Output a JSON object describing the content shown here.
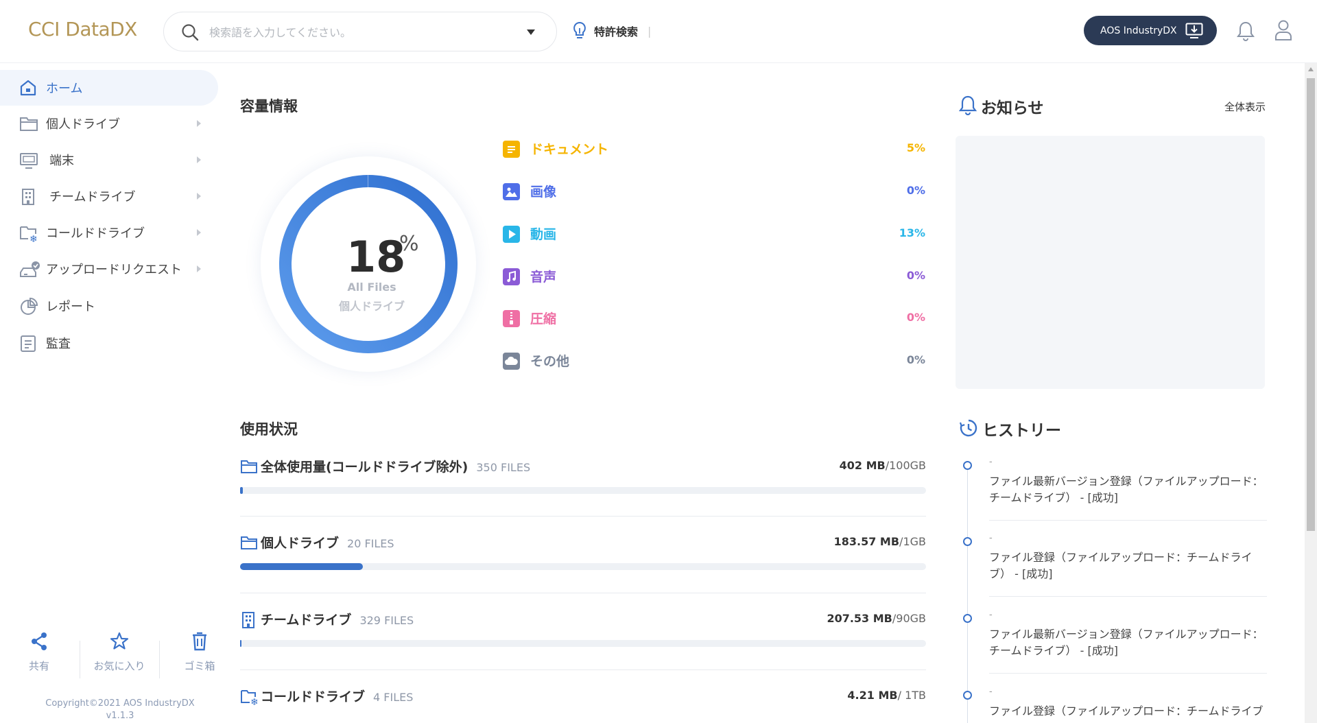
{
  "app": {
    "logo": "CCI DataDX"
  },
  "header": {
    "search_placeholder": "検索語を入力してください。",
    "patent_search": "特許検索",
    "separator": "|",
    "aos_button": "AOS IndustryDX"
  },
  "sidebar": {
    "items": [
      {
        "label": "ホーム",
        "icon": "home-icon",
        "active": true,
        "arrow": false
      },
      {
        "label": "個人ドライブ",
        "icon": "folder-icon",
        "arrow": true
      },
      {
        "label": "端末",
        "icon": "monitor-icon",
        "arrow": true
      },
      {
        "label": "チームドライブ",
        "icon": "building-icon",
        "arrow": true
      },
      {
        "label": "コールドドライブ",
        "icon": "cold-drive-icon",
        "arrow": true
      },
      {
        "label": "アップロードリクエスト",
        "icon": "upload-request-icon",
        "arrow": true
      },
      {
        "label": "レポート",
        "icon": "pie-chart-icon",
        "arrow": false
      },
      {
        "label": "監査",
        "icon": "audit-icon",
        "arrow": false
      }
    ],
    "bottom": {
      "share": "共有",
      "favorites": "お気に入り",
      "trash": "ゴミ箱"
    },
    "copyright": "Copyright©2021 AOS IndustryDX",
    "version": "v1.1.3"
  },
  "capacity": {
    "title": "容量情報",
    "percent": "18",
    "percent_sign": "%",
    "percent_value": 18,
    "all_files": "All Files",
    "drive_label": "個人ドライブ",
    "categories": [
      {
        "name": "ドキュメント",
        "value": "5%",
        "color": "#f5b400"
      },
      {
        "name": "画像",
        "value": "0%",
        "color": "#4f6ee8"
      },
      {
        "name": "動画",
        "value": "13%",
        "color": "#29b6e8"
      },
      {
        "name": "音声",
        "value": "0%",
        "color": "#8b5bd6"
      },
      {
        "name": "圧縮",
        "value": "0%",
        "color": "#ef6fa4"
      },
      {
        "name": "その他",
        "value": "0%",
        "color": "#7b8699"
      }
    ]
  },
  "usage": {
    "title": "使用状況",
    "rows": [
      {
        "name": "全体使用量(コールドドライブ除外)",
        "files": "350 FILES",
        "used": "402 MB",
        "total": "/100GB",
        "fill": 0.004
      },
      {
        "name": "個人ドライブ",
        "files": "20 FILES",
        "used": "183.57 MB",
        "total": "/1GB",
        "fill": 0.1793
      },
      {
        "name": "チームドライブ",
        "files": "329 FILES",
        "used": "207.53 MB",
        "total": "/90GB",
        "fill": 0.0023
      },
      {
        "name": "コールドドライブ",
        "files": "4 FILES",
        "used": "4.21 MB",
        "total": "/ 1TB",
        "fill": 0.0
      }
    ]
  },
  "news": {
    "title": "お知らせ",
    "show_all": "全体表示"
  },
  "history": {
    "title": "ヒストリー",
    "items": [
      {
        "date": "-",
        "text": "ファイル最新バージョン登録（ファイルアップロード：チームドライブ） - [成功]"
      },
      {
        "date": "-",
        "text": "ファイル登録（ファイルアップロード：チームドライブ） - [成功]"
      },
      {
        "date": "-",
        "text": "ファイル最新バージョン登録（ファイルアップロード：チームドライブ） - [成功]"
      },
      {
        "date": "-",
        "text": "ファイル登録（ファイルアップロード：チームドライブ"
      }
    ]
  },
  "colors": {
    "accent": "#3a72c9",
    "navy": "#2b3a55",
    "logo": "#b39656"
  }
}
